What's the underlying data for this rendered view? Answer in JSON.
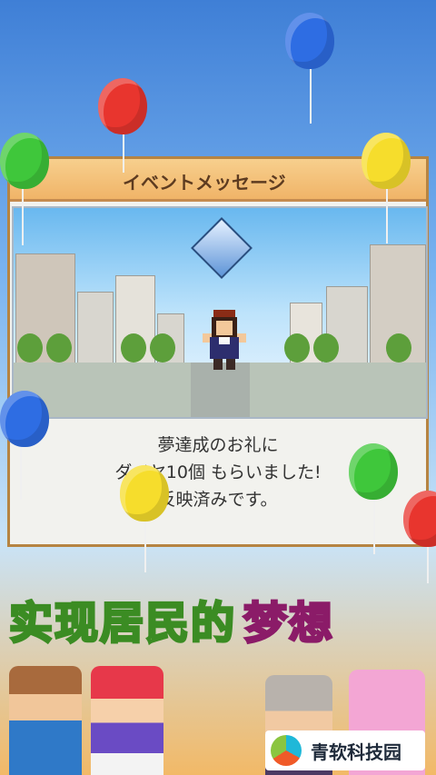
{
  "dialog": {
    "title": "イベントメッセージ",
    "message_lines": [
      "夢達成のお礼に",
      "ダイヤ10個 もらいました!",
      "反映済みです。"
    ]
  },
  "banner": {
    "main": "实现居民的",
    "accent": "梦想"
  },
  "watermark": {
    "text": "青软科技园"
  },
  "colors": {
    "balloon_red": "#e8352e",
    "balloon_blue": "#2e6de3",
    "balloon_green": "#3fc73b",
    "balloon_yellow": "#f6dd2c"
  }
}
